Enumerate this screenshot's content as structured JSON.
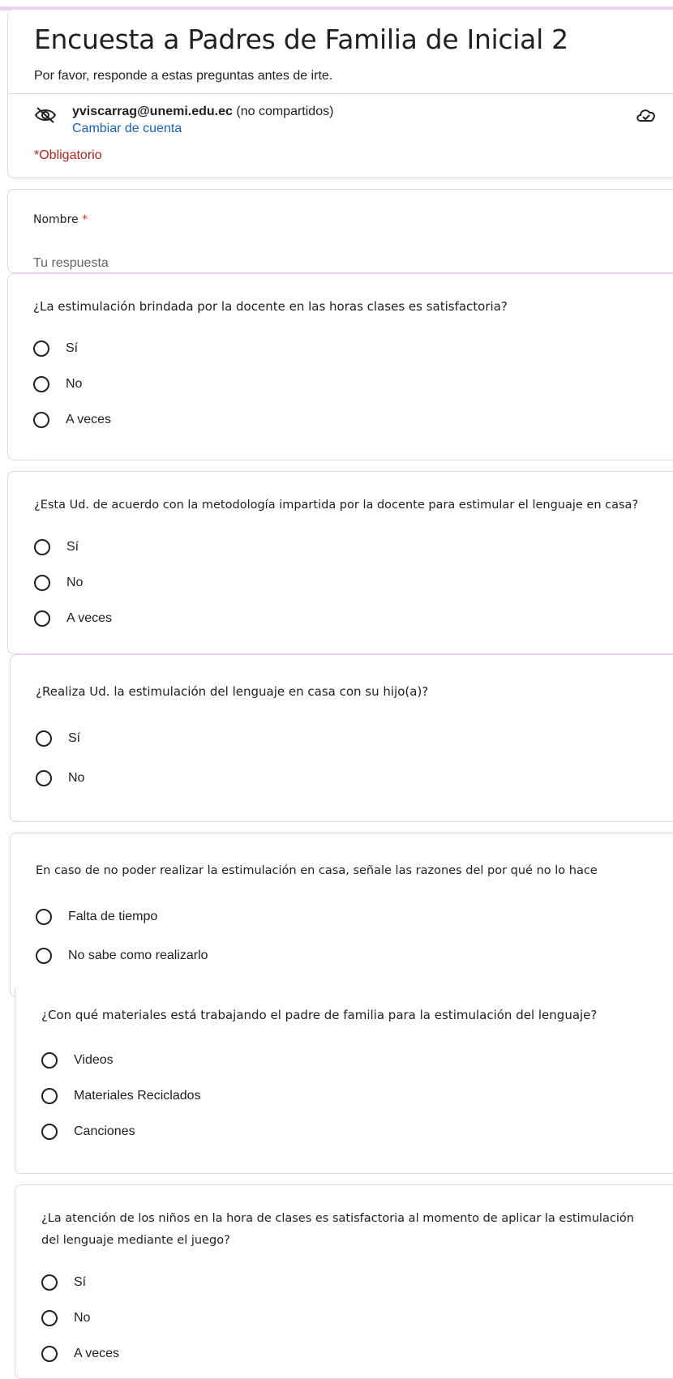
{
  "form": {
    "title": "Encuesta a Padres de Familia de Inicial 2",
    "description": "Por favor, responde a estas preguntas antes de irte.",
    "account_email": "yviscarrag@unemi.edu.ec",
    "account_note": "(no compartidos)",
    "switch_account": "Cambiar de cuenta",
    "required_note": "*Obligatorio"
  },
  "name_question": {
    "label": "Nombre",
    "required_mark": "*",
    "placeholder": "Tu respuesta"
  },
  "questions": [
    {
      "text": "¿La estimulación brindada por la docente en las horas clases es satisfactoria?",
      "options": [
        "Sí",
        "No",
        "A veces"
      ]
    },
    {
      "text": "¿Esta Ud. de acuerdo con la metodología impartida por la docente para estimular el lenguaje en casa?",
      "options": [
        "Sí",
        "No",
        "A veces"
      ]
    },
    {
      "text": "¿Realiza Ud. la estimulación del lenguaje en casa con su hijo(a)?",
      "options": [
        "Sí",
        "No"
      ]
    },
    {
      "text": "En caso de no poder realizar la estimulación en casa, señale las razones del por qué no lo hace",
      "options": [
        "Falta de tiempo",
        "No sabe como realizarlo"
      ]
    },
    {
      "text": "¿Con qué materiales está trabajando el padre de familia para la estimulación del lenguaje?",
      "options": [
        "Videos",
        "Materiales Reciclados",
        "Canciones"
      ]
    },
    {
      "text_line1": "¿La atención de los niños en la hora de clases es satisfactoria al momento de aplicar la estimulación",
      "text_line2": "del lenguaje mediante el juego?",
      "options": [
        "Sí",
        "No",
        "A veces"
      ]
    }
  ],
  "icons": {
    "account_visibility": "eye-off-icon",
    "cloud_status": "cloud-check-icon"
  },
  "colors": {
    "accent": "#e9d4ee",
    "card_border": "#e3d3ea",
    "link": "#1a62b8",
    "required": "#b3261e"
  }
}
